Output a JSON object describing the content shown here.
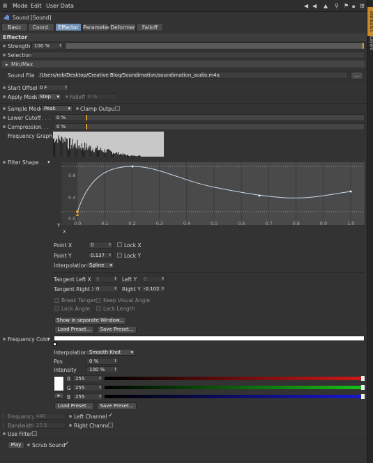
{
  "menubar": {
    "items": [
      "Mode",
      "Edit",
      "User Data"
    ]
  },
  "sidebar": {
    "tabs": [
      "Attributes",
      "Layers"
    ]
  },
  "object": {
    "title": "Sound [Sound]"
  },
  "tabs": [
    "Basic",
    "Coord.",
    "Effector",
    "Parameter",
    "Deformer",
    "Falloff"
  ],
  "active_tab": "Effector",
  "effector": {
    "section_title": "Effector",
    "strength_label": "Strength",
    "strength_value": "100 %",
    "strength_fraction": 1.0,
    "selection_label": "Selection",
    "minmax_label": "Min/Max",
    "soundfile_label": "Sound File",
    "soundfile_value": "/Users/rob/Desktop/Creative Bloq/Soundimation/soundimation_audio.m4a",
    "browse_label": "...",
    "start_offset_label": "Start Offset",
    "start_offset_value": "0 F",
    "apply_mode_label": "Apply Mode",
    "apply_mode_value": "Step",
    "falloff_label": "Falloff",
    "falloff_value": "0 %",
    "sample_mode_label": "Sample Mode",
    "sample_mode_value": "Peak",
    "clamp_output_label": "Clamp Output",
    "lower_cutoff_label": "Lower Cutoff",
    "lower_cutoff_value": "0 %",
    "compression_label": "Compression",
    "compression_value": "0 %",
    "frequency_graph_label": "Frequency Graph"
  },
  "filter_shape": {
    "label": "Filter Shape",
    "y_label": "Y",
    "x_label": "X",
    "y_ticks": [
      "0.8",
      "0.4",
      "0.0"
    ],
    "x_ticks": [
      "0.0",
      "0.1",
      "0.2",
      "0.3",
      "0.4",
      "0.5",
      "0.6",
      "0.7",
      "0.8",
      "0.9",
      "1.0"
    ],
    "point_x_label": "Point X",
    "point_x_value": "0",
    "lock_x_label": "Lock X",
    "point_y_label": "Point Y",
    "point_y_value": "0.137",
    "lock_y_label": "Lock Y",
    "interpolation_label": "Interpolation",
    "interpolation_value": "Spline",
    "tangent_left_x_label": "Tangent Left X",
    "tangent_left_x_value": "0",
    "left_y_label": "Left Y",
    "left_y_value": "0",
    "tangent_right_x_label": "Tangent Right X",
    "tangent_right_x_value": "0",
    "right_y_label": "Right Y",
    "right_y_value": "-0.102",
    "break_tangent_label": "Break Tangent",
    "keep_visual_angle_label": "Keep Visual Angle",
    "lock_angle_label": "Lock Angle",
    "lock_length_label": "Lock Length",
    "show_window_label": "Show in separate Window...",
    "load_preset_label": "Load Preset...",
    "save_preset_label": "Save Preset..."
  },
  "frequency_color": {
    "label": "Frequency Color",
    "interpolation_label": "Interpolation",
    "interpolation_value": "Smooth Knot",
    "pos_label": "Pos",
    "pos_value": "0 %",
    "intensity_label": "Intensity",
    "intensity_value": "100 %",
    "r_label": "R",
    "r_value": "255",
    "g_label": "G",
    "g_value": "255",
    "b_label": "B",
    "b_value": "255",
    "load_preset_label": "Load Preset...",
    "save_preset_label": "Save Preset..."
  },
  "bottom": {
    "frequency_label": "Frequency",
    "frequency_value": "440",
    "bandwidth_label": "Bandwidth",
    "bandwidth_value": "27.5",
    "left_channel_label": "Left Channel",
    "right_channel_label": "Right Channel",
    "use_filter_label": "Use Filter",
    "play_label": "Play",
    "scrub_sound_label": "Scrub Sound"
  },
  "colors": {
    "accent": "#e0a030",
    "active_tab": "#6e8fb3",
    "curve": "#c8dcf0",
    "red": "#d01818",
    "green": "#18c018",
    "blue": "#1818d0"
  }
}
